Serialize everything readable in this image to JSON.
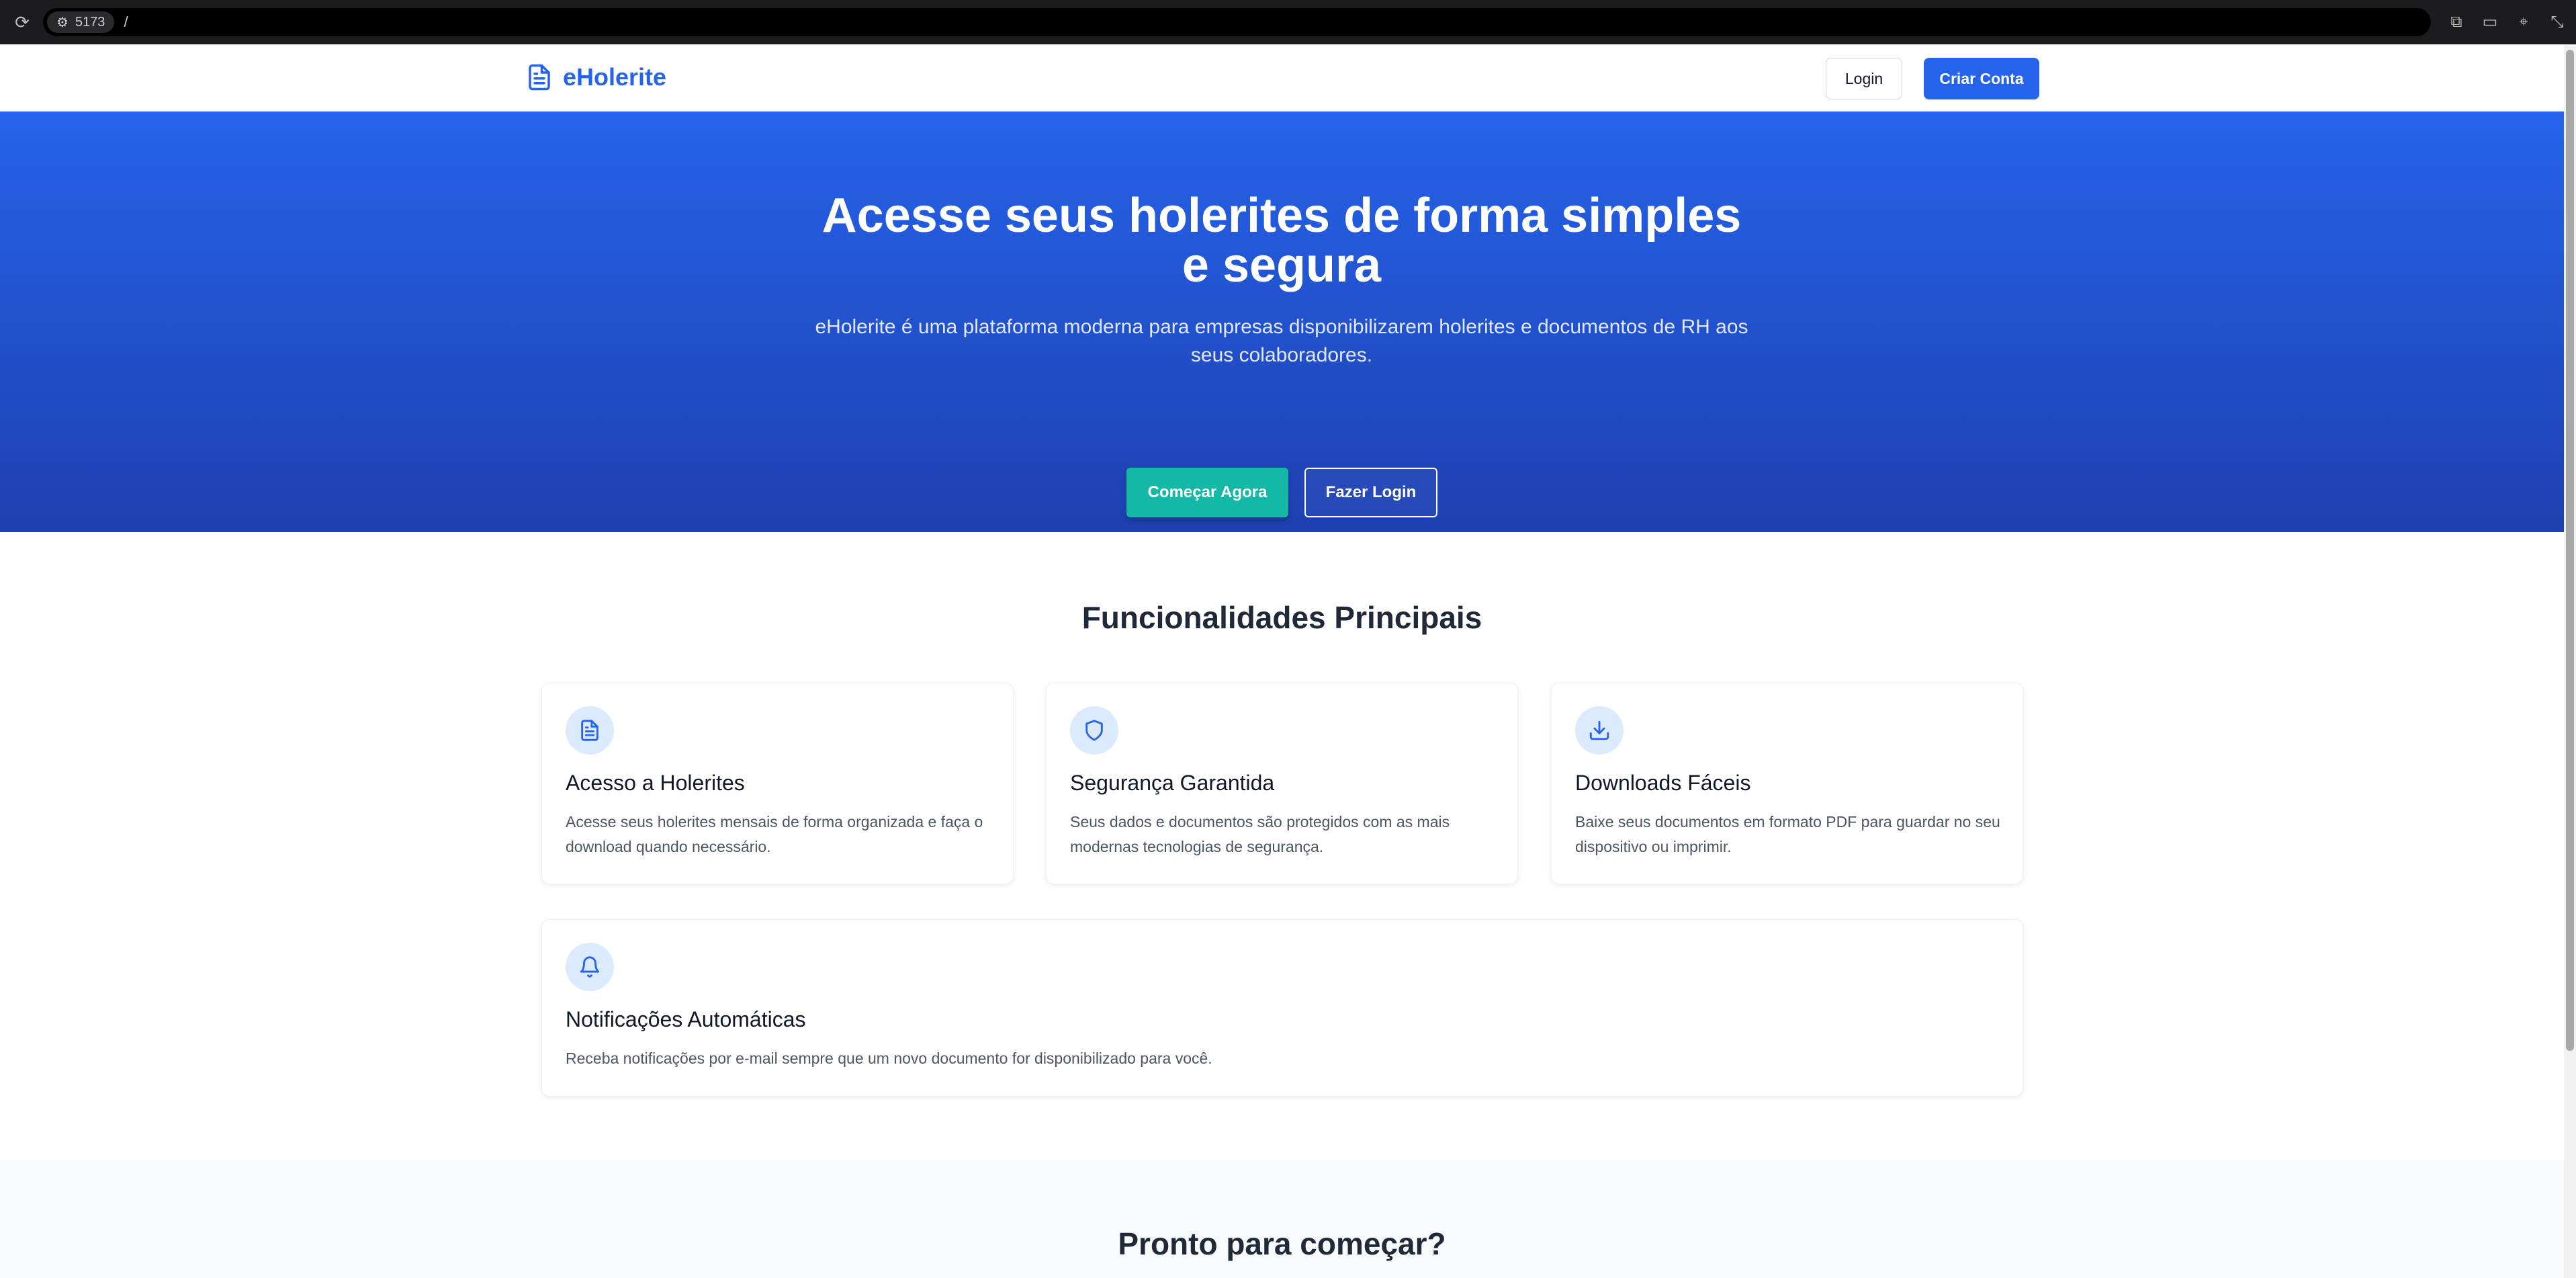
{
  "browser": {
    "url_chip": "5173",
    "url_path": "/"
  },
  "nav": {
    "brand": "eHolerite",
    "login_label": "Login",
    "signup_label": "Criar Conta"
  },
  "hero": {
    "title": "Acesse seus holerites de forma simples e segura",
    "subtitle": "eHolerite é uma plataforma moderna para empresas disponibilizarem holerites e documentos de RH aos seus colaboradores.",
    "start_label": "Começar Agora",
    "login_label": "Fazer Login"
  },
  "features": {
    "title": "Funcionalidades Principais",
    "items": [
      {
        "icon": "document-icon",
        "title": "Acesso a Holerites",
        "description": "Acesse seus holerites mensais de forma organizada e faça o download quando necessário."
      },
      {
        "icon": "shield-icon",
        "title": "Segurança Garantida",
        "description": "Seus dados e documentos são protegidos com as mais modernas tecnologias de segurança."
      },
      {
        "icon": "download-icon",
        "title": "Downloads Fáceis",
        "description": "Baixe seus documentos em formato PDF para guardar no seu dispositivo ou imprimir."
      },
      {
        "icon": "bell-icon",
        "title": "Notificações Automáticas",
        "description": "Receba notificações por e-mail sempre que um novo documento for disponibilizado para você."
      }
    ]
  },
  "cta": {
    "title": "Pronto para começar?"
  },
  "colors": {
    "brand": "#2563eb",
    "accent": "#14b8a6",
    "icon_bg": "#dbeafe"
  }
}
